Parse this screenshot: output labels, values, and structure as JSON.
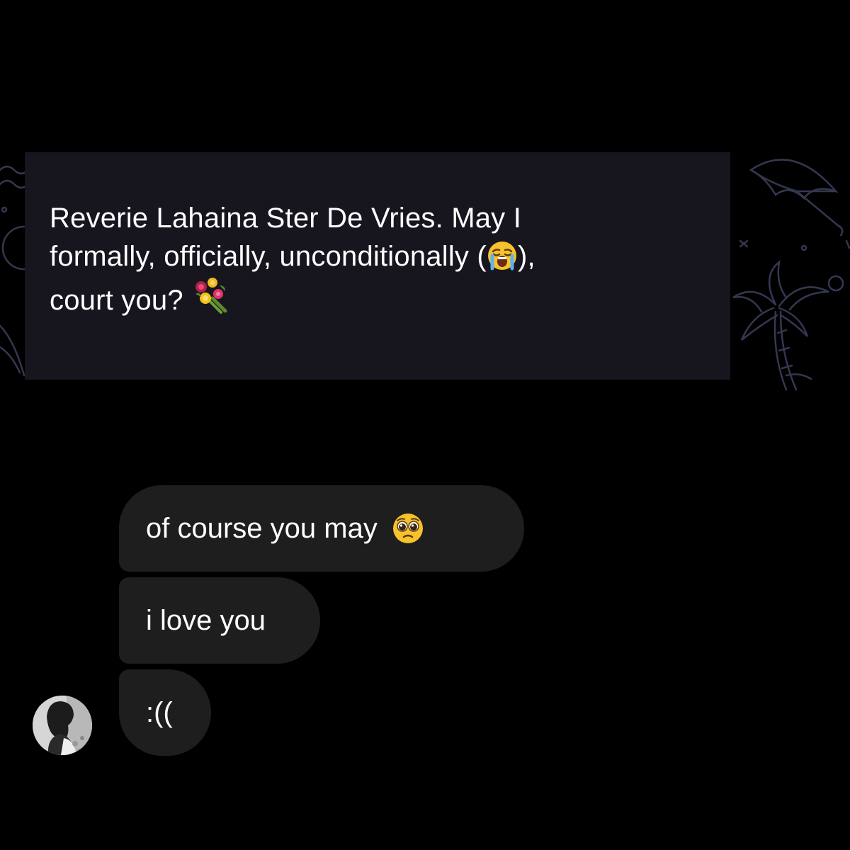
{
  "note": {
    "line1": "Reverie Lahaina Ster De Vries. May I",
    "line2_before": "formally, officially, unconditionally (",
    "line2_emoji": "loudly-crying-face-emoji",
    "line2_after": "),",
    "line3_text": "court you?",
    "line3_emoji": "bouquet-emoji"
  },
  "messages": [
    {
      "text": "of course you may",
      "emoji": "pleading-face-emoji"
    },
    {
      "text": "i love you"
    },
    {
      "text": ":(("
    }
  ],
  "avatar": {
    "icon": "profile-photo-avatar"
  },
  "colors": {
    "background": "#000000",
    "note_card": "#17161f",
    "bubble": "#1e1e1e",
    "text": "#ffffff",
    "doodle": "#3a3d55"
  }
}
